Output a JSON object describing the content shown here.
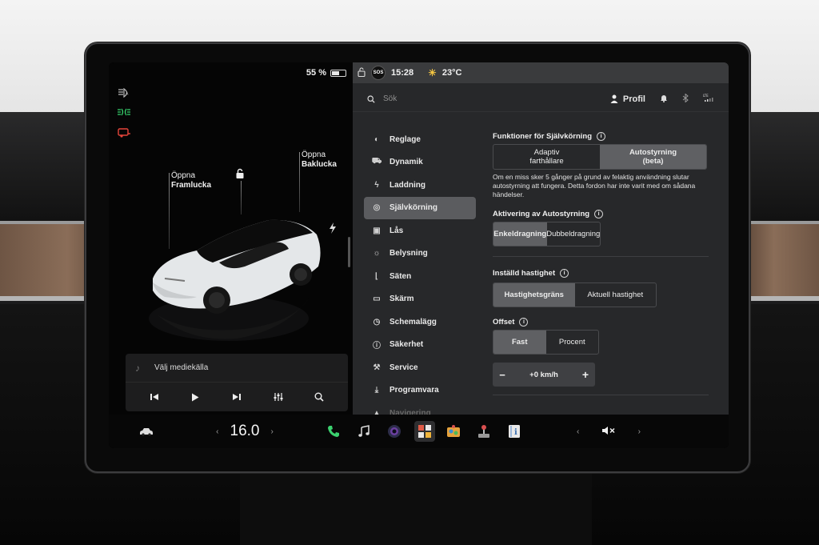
{
  "status": {
    "battery_percent_label": "55 %",
    "battery_level": 0.55,
    "time": "15:28",
    "temperature": "23°C",
    "sos_label": "SOS"
  },
  "car": {
    "frunk_label_1": "Öppna",
    "frunk_label_2": "Framlucka",
    "trunk_label_1": "Öppna",
    "trunk_label_2": "Baklucka",
    "body_color": "#e9ecee"
  },
  "indicators": [
    "auto-headlights-icon",
    "parking-lights-icon",
    "trailer-warning-icon"
  ],
  "media": {
    "source_label": "Välj mediekälla"
  },
  "header": {
    "search_placeholder": "Sök",
    "profile_label": "Profil"
  },
  "nav": {
    "items": [
      {
        "label": "Reglage",
        "icon": "toggle-icon"
      },
      {
        "label": "Dynamik",
        "icon": "car-icon"
      },
      {
        "label": "Laddning",
        "icon": "bolt-icon"
      },
      {
        "label": "Självkörning",
        "icon": "steering-wheel-icon",
        "active": true
      },
      {
        "label": "Lås",
        "icon": "lock-icon"
      },
      {
        "label": "Belysning",
        "icon": "sun-icon"
      },
      {
        "label": "Säten",
        "icon": "seat-icon"
      },
      {
        "label": "Skärm",
        "icon": "display-icon"
      },
      {
        "label": "Schemalägg",
        "icon": "alarm-icon"
      },
      {
        "label": "Säkerhet",
        "icon": "info-icon"
      },
      {
        "label": "Service",
        "icon": "wrench-icon"
      },
      {
        "label": "Programvara",
        "icon": "download-icon"
      },
      {
        "label": "Navigering",
        "icon": "navigation-icon"
      }
    ]
  },
  "autopilot": {
    "features_title": "Funktioner för Självkörning",
    "features_options": [
      "Adaptiv farthållare",
      "Autostyrning (beta)"
    ],
    "features_selected": 1,
    "features_desc": "Om en miss sker 5 gånger på grund av felaktig användning slutar autostyrning att fungera. Detta fordon har inte varit med om sådana händelser.",
    "activation_title": "Aktivering av Autostyrning",
    "activation_options": [
      "Enkeldragning",
      "Dubbeldragning"
    ],
    "activation_selected": 0,
    "speed_title": "Inställd hastighet",
    "speed_options": [
      "Hastighetsgräns",
      "Aktuell hastighet"
    ],
    "speed_selected": 0,
    "offset_title": "Offset",
    "offset_options": [
      "Fast",
      "Procent"
    ],
    "offset_selected": 0,
    "offset_value": "+0 km/h",
    "minus_label": "−",
    "plus_label": "+"
  },
  "dock": {
    "cabin_temp": "16.0",
    "temp_left_arrow": "‹",
    "temp_right_arrow": "›",
    "vol_left_arrow": "‹",
    "vol_right_arrow": "›",
    "apps": [
      "phone-icon",
      "music-icon",
      "camera-icon",
      "toybox-icon",
      "arcade-icon",
      "joystick-icon",
      "manual-icon"
    ],
    "accent_green": "#3bd16f"
  }
}
